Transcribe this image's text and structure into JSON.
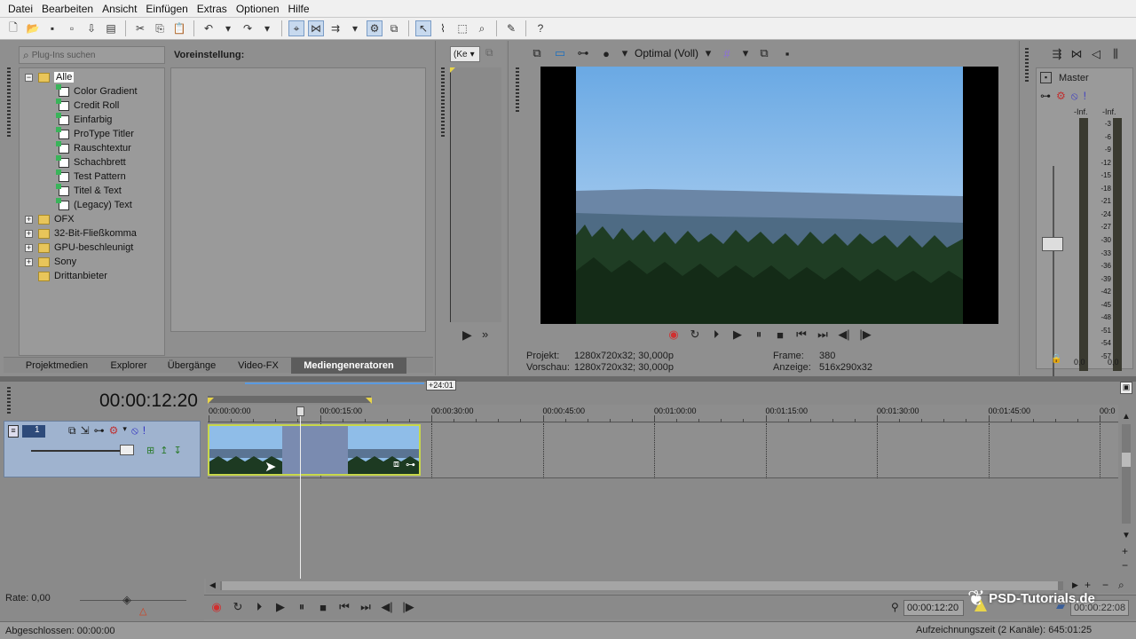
{
  "menu": [
    "Datei",
    "Bearbeiten",
    "Ansicht",
    "Einfügen",
    "Extras",
    "Optionen",
    "Hilfe"
  ],
  "plugin_search": {
    "placeholder": "Plug-Ins suchen"
  },
  "preset_label": "Voreinstellung:",
  "tree": {
    "root": "Alle",
    "children": [
      "Color Gradient",
      "Credit Roll",
      "Einfarbig",
      "ProType Titler",
      "Rauschtextur",
      "Schachbrett",
      "Test Pattern",
      "Titel & Text",
      "(Legacy) Text"
    ],
    "folders": [
      "OFX",
      "32-Bit-Fließkomma",
      "GPU-beschleunigt",
      "Sony",
      "Drittanbieter"
    ]
  },
  "tabs": [
    "Projektmedien",
    "Explorer",
    "Übergänge",
    "Video-FX",
    "Mediengeneratoren"
  ],
  "active_tab": "Mediengeneratoren",
  "trimmer_dropdown": "(Ke",
  "preview": {
    "quality": "Optimal (Voll)",
    "projekt_label": "Projekt:",
    "projekt_value": "1280x720x32; 30,000p",
    "vorschau_label": "Vorschau:",
    "vorschau_value": "1280x720x32; 30,000p",
    "frame_label": "Frame:",
    "frame_value": "380",
    "anzeige_label": "Anzeige:",
    "anzeige_value": "516x290x32"
  },
  "master": {
    "title": "Master",
    "left_label": "-Inf.",
    "right_label": "-Inf.",
    "scale": [
      "3",
      "6",
      "9",
      "12",
      "15",
      "18",
      "21",
      "24",
      "27",
      "30",
      "33",
      "36",
      "39",
      "42",
      "45",
      "48",
      "51",
      "54",
      "57"
    ],
    "left_value": "0,0",
    "right_value": "0,0"
  },
  "timeline": {
    "timecode": "00:00:12:20",
    "loop_end_label": "+24:01",
    "ruler": [
      "00:00:00:00",
      "00:00:15:00",
      "00:00:30:00",
      "00:00:45:00",
      "00:01:00:00",
      "00:01:15:00",
      "00:01:30:00",
      "00:01:45:00",
      "00:0"
    ],
    "track_number": "1"
  },
  "status": {
    "rate_label": "Rate: 0,00",
    "completed": "Abgeschlossen: 00:00:00",
    "cursor_time": "00:00:12:20",
    "end_time": "00:00:22:08",
    "record_time": "Aufzeichnungszeit (2 Kanäle): 645:01:25",
    "watermark": "PSD-Tutorials.de"
  },
  "colors": {
    "accent": "#3a7fd5",
    "record": "#d03030",
    "clip_border": "#c8d84a"
  }
}
